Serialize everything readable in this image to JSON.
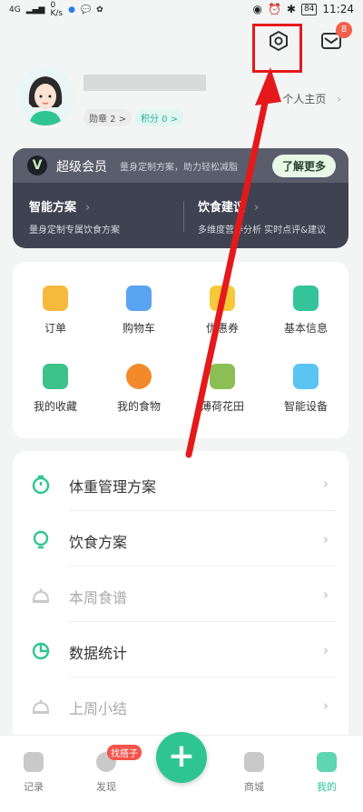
{
  "status": {
    "network": "4G",
    "speed": "0\nK/s",
    "battery": "84",
    "time": "11:24"
  },
  "top": {
    "mail_badge": "8"
  },
  "profile": {
    "medal_label": "勋章 2 >",
    "points_label": "积分 0 >",
    "homepage_label": "个人主页"
  },
  "vip": {
    "title": "超级会员",
    "desc": "量身定制方案，助力轻松减脂",
    "more_label": "了解更多",
    "cols": [
      {
        "title": "智能方案",
        "sub": "量身定制专属饮食方案"
      },
      {
        "title": "饮食建议",
        "sub": "多维度营养分析 实时点评&建议"
      }
    ]
  },
  "grid": [
    {
      "label": "订单",
      "color": "#f7b93c"
    },
    {
      "label": "购物车",
      "color": "#5aa3f0"
    },
    {
      "label": "优惠券",
      "color": "#f5c93a"
    },
    {
      "label": "基本信息",
      "color": "#35c39a"
    },
    {
      "label": "我的收藏",
      "color": "#3cc38a"
    },
    {
      "label": "我的食物",
      "color": "#f28a2c"
    },
    {
      "label": "薄荷花田",
      "color": "#8bbf54"
    },
    {
      "label": "智能设备",
      "color": "#5bc4f2"
    }
  ],
  "list": [
    {
      "label": "体重管理方案",
      "active": true
    },
    {
      "label": "饮食方案",
      "active": true
    },
    {
      "label": "本周食谱",
      "active": false
    },
    {
      "label": "数据统计",
      "active": true
    },
    {
      "label": "上周小结",
      "active": false
    }
  ],
  "tabs": [
    {
      "label": "记录"
    },
    {
      "label": "发现"
    },
    {
      "label": "商城"
    },
    {
      "label": "我的"
    }
  ],
  "tag_label": "找搭子",
  "fab_label": "+",
  "colors": {
    "accent": "#2fc592",
    "arrow": "#e5191b"
  }
}
